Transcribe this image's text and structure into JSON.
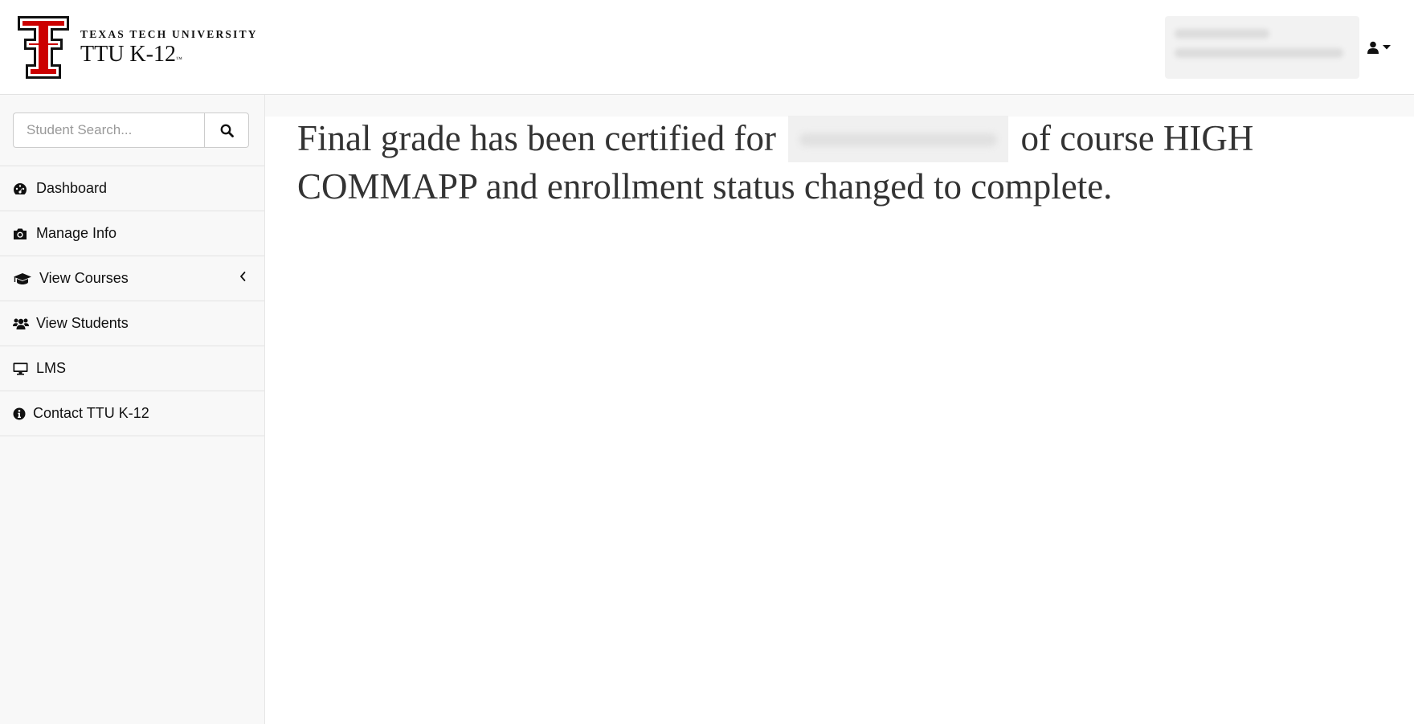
{
  "header": {
    "brand_top": "TEXAS TECH UNIVERSITY",
    "brand_bottom": "TTU K-12",
    "brand_mark": "™",
    "brand_color": "#cc0000"
  },
  "sidebar": {
    "search_placeholder": "Student Search...",
    "items": [
      {
        "label": "Dashboard",
        "icon": "dashboard-icon"
      },
      {
        "label": "Manage Info",
        "icon": "camera-icon"
      },
      {
        "label": "View Courses",
        "icon": "graduation-cap-icon",
        "expandable": true
      },
      {
        "label": "View Students",
        "icon": "users-icon"
      },
      {
        "label": "LMS",
        "icon": "desktop-icon"
      },
      {
        "label": "Contact TTU K-12",
        "icon": "info-circle-icon"
      }
    ]
  },
  "main": {
    "message_part1": "Final grade has been certified for",
    "message_part2": "of course HIGH COMMAPP and enrollment status changed to complete."
  }
}
